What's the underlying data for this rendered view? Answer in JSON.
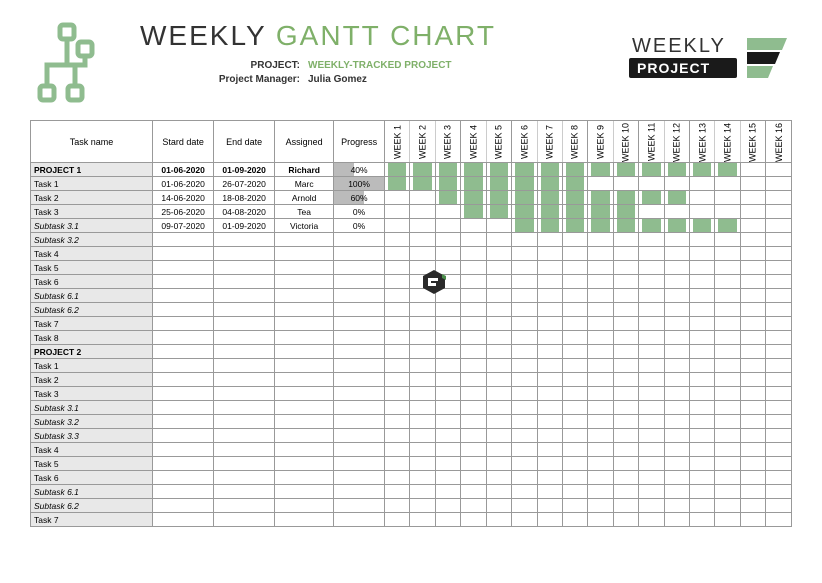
{
  "title_part1": "WEEKLY ",
  "title_part2": "GANTT CHART",
  "meta": {
    "project_label": "PROJECT:",
    "project_value": "WEEKLY-TRACKED PROJECT",
    "manager_label": "Project Manager:",
    "manager_value": "Julia Gomez"
  },
  "logo_right_text1": "WEEKLY",
  "logo_right_text2": "PROJECT",
  "headers": {
    "task": "Task name",
    "start": "Stard date",
    "end": "End date",
    "assigned": "Assigned",
    "progress": "Progress"
  },
  "weeks": [
    "WEEK 1",
    "WEEK 2",
    "WEEK 3",
    "WEEK 4",
    "WEEK 5",
    "WEEK 6",
    "WEEK 7",
    "WEEK 8",
    "WEEK 9",
    "WEEK 10",
    "WEEK 11",
    "WEEK 12",
    "WEEK 13",
    "WEEK 14",
    "WEEK 15",
    "WEEK 16"
  ],
  "rows": [
    {
      "name": "PROJECT 1",
      "start": "01-06-2020",
      "end": "01-09-2020",
      "assigned": "Richard",
      "progress": "40%",
      "progressPct": 40,
      "bold": true,
      "bars": [
        1,
        2,
        3,
        4,
        5,
        6,
        7,
        8,
        9,
        10,
        11,
        12,
        13,
        14
      ]
    },
    {
      "name": "Task 1",
      "start": "01-06-2020",
      "end": "26-07-2020",
      "assigned": "Marc",
      "progress": "100%",
      "progressPct": 100,
      "bars": [
        1,
        2,
        3,
        4,
        5,
        6,
        7,
        8
      ]
    },
    {
      "name": "Task 2",
      "start": "14-06-2020",
      "end": "18-08-2020",
      "assigned": "Arnold",
      "progress": "60%",
      "progressPct": 60,
      "bars": [
        3,
        4,
        5,
        6,
        7,
        8,
        9,
        10,
        11,
        12
      ]
    },
    {
      "name": "Task 3",
      "start": "25-06-2020",
      "end": "04-08-2020",
      "assigned": "Tea",
      "progress": "0%",
      "progressPct": 0,
      "bars": [
        4,
        5,
        6,
        7,
        8,
        9,
        10
      ]
    },
    {
      "name": "Subtask 3.1",
      "start": "09-07-2020",
      "end": "01-09-2020",
      "assigned": "Victoria",
      "progress": "0%",
      "progressPct": 0,
      "italic": true,
      "bars": [
        6,
        7,
        8,
        9,
        10,
        11,
        12,
        13,
        14
      ]
    },
    {
      "name": "Subtask 3.2",
      "italic": true,
      "bars": []
    },
    {
      "name": "Task 4",
      "bars": []
    },
    {
      "name": "Task 5",
      "bars": []
    },
    {
      "name": "Task 6",
      "bars": []
    },
    {
      "name": "Subtask 6.1",
      "italic": true,
      "bars": []
    },
    {
      "name": "Subtask 6.2",
      "italic": true,
      "bars": []
    },
    {
      "name": "Task 7",
      "bars": []
    },
    {
      "name": "Task 8",
      "bars": []
    },
    {
      "name": "PROJECT 2",
      "bold": true,
      "bars": []
    },
    {
      "name": "Task 1",
      "bars": []
    },
    {
      "name": "Task 2",
      "bars": []
    },
    {
      "name": "Task 3",
      "bars": []
    },
    {
      "name": "Subtask 3.1",
      "italic": true,
      "bars": []
    },
    {
      "name": "Subtask 3.2",
      "italic": true,
      "bars": []
    },
    {
      "name": "Subtask 3.3",
      "italic": true,
      "bars": []
    },
    {
      "name": "Task 4",
      "bars": []
    },
    {
      "name": "Task 5",
      "bars": []
    },
    {
      "name": "Task 6",
      "bars": []
    },
    {
      "name": "Subtask 6.1",
      "italic": true,
      "bars": []
    },
    {
      "name": "Subtask 6.2",
      "italic": true,
      "bars": []
    },
    {
      "name": "Task 7",
      "bars": []
    }
  ],
  "chart_data": {
    "type": "gantt",
    "x_unit": "week",
    "x_labels": [
      "WEEK 1",
      "WEEK 2",
      "WEEK 3",
      "WEEK 4",
      "WEEK 5",
      "WEEK 6",
      "WEEK 7",
      "WEEK 8",
      "WEEK 9",
      "WEEK 10",
      "WEEK 11",
      "WEEK 12",
      "WEEK 13",
      "WEEK 14",
      "WEEK 15",
      "WEEK 16"
    ],
    "tasks": [
      {
        "name": "PROJECT 1",
        "start": "01-06-2020",
        "end": "01-09-2020",
        "assigned": "Richard",
        "progress_pct": 40,
        "bar_weeks": [
          1,
          14
        ]
      },
      {
        "name": "Task 1",
        "start": "01-06-2020",
        "end": "26-07-2020",
        "assigned": "Marc",
        "progress_pct": 100,
        "bar_weeks": [
          1,
          8
        ]
      },
      {
        "name": "Task 2",
        "start": "14-06-2020",
        "end": "18-08-2020",
        "assigned": "Arnold",
        "progress_pct": 60,
        "bar_weeks": [
          3,
          12
        ]
      },
      {
        "name": "Task 3",
        "start": "25-06-2020",
        "end": "04-08-2020",
        "assigned": "Tea",
        "progress_pct": 0,
        "bar_weeks": [
          4,
          10
        ]
      },
      {
        "name": "Subtask 3.1",
        "start": "09-07-2020",
        "end": "01-09-2020",
        "assigned": "Victoria",
        "progress_pct": 0,
        "bar_weeks": [
          6,
          14
        ]
      }
    ]
  }
}
